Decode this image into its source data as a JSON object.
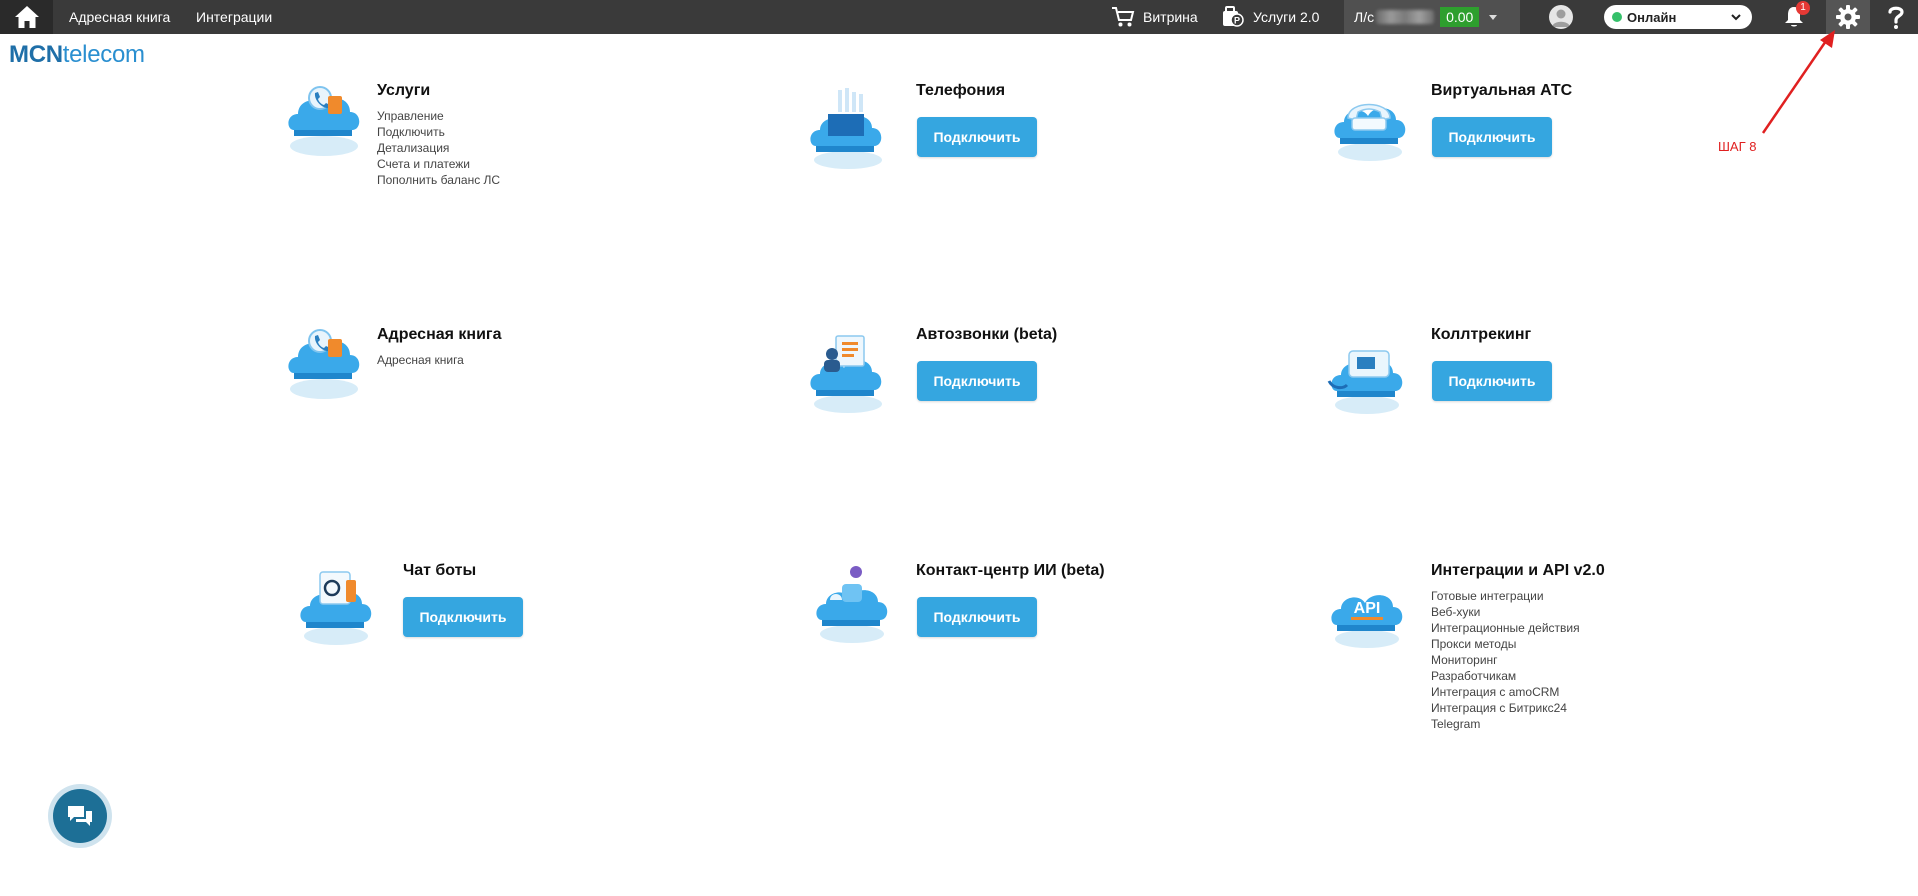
{
  "topbar": {
    "nav": [
      "Адресная книга",
      "Интеграции"
    ],
    "showcase_label": "Витрина",
    "services_label": "Услуги 2.0",
    "account_label": "Л/с",
    "account_balance": "0.00",
    "status_label": "Онлайн",
    "notifications_count": "1"
  },
  "logo": {
    "bold": "MCN",
    "regular": "telecom"
  },
  "cards": [
    {
      "title": "Услуги",
      "links": [
        "Управление",
        "Подключить",
        "Детализация",
        "Счета и платежи",
        "Пополнить баланс ЛС"
      ]
    },
    {
      "title": "Телефония",
      "button": "Подключить"
    },
    {
      "title": "Виртуальная АТС",
      "button": "Подключить"
    },
    {
      "title": "Адресная книга",
      "links": [
        "Адресная книга"
      ]
    },
    {
      "title": "Автозвонки (beta)",
      "button": "Подключить"
    },
    {
      "title": "Коллтрекинг",
      "button": "Подключить"
    },
    {
      "title": "Чат боты",
      "button": "Подключить"
    },
    {
      "title": "Контакт-центр ИИ (beta)",
      "button": "Подключить"
    },
    {
      "title": "Интеграции и API v2.0",
      "links": [
        "Готовые интеграции",
        "Веб-хуки",
        "Интеграционные действия",
        "Прокси методы",
        "Мониторинг",
        "Разработчикам",
        "Интеграция с amoCRM",
        "Интеграция с Битрикс24",
        "Telegram"
      ]
    }
  ],
  "annotation": {
    "step": "ШАГ 8"
  },
  "colors": {
    "topbar": "#3a3a3a",
    "accent_button": "#35a6e0",
    "balance": "#2e9f2e",
    "annotation": "#e02020",
    "logo": "#1f6fa8"
  },
  "icons": [
    "home-icon",
    "cart-icon",
    "services-icon",
    "avatar-icon",
    "chevron-down-icon",
    "bell-icon",
    "gear-icon",
    "help-icon",
    "chat-icon",
    "cloud-icon"
  ]
}
